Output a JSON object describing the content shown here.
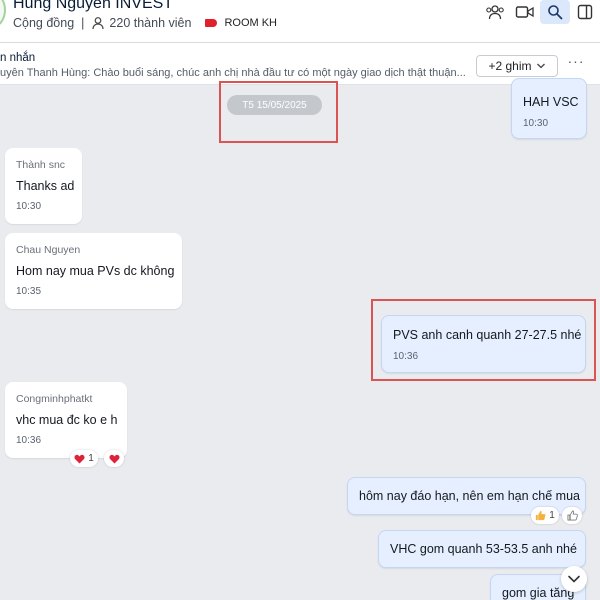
{
  "header": {
    "title": "Hùng Nguyễn INVEST",
    "community_label": "Cộng đồng",
    "member_count": "220 thành viên",
    "tag_label": "ROOM KH",
    "tag_color": "#e0202a",
    "icons": [
      "group-add-icon",
      "video-call-icon",
      "search-icon",
      "sidebar-toggle-icon"
    ]
  },
  "pinned": {
    "title": "n nhắn",
    "preview": "uyễn Thanh Hùng: Chào buổi sáng, chúc anh chị nhà đầu tư có một ngày giao dịch thật thuận...",
    "pins_button": "+2 ghim",
    "more_label": "···"
  },
  "date_divider": "T5 15/05/2025",
  "messages": [
    {
      "text": "HAH VSC",
      "time": "10:30"
    },
    {
      "sender": "Thành snc",
      "text": "Thanks ad",
      "time": "10:30"
    },
    {
      "sender": "Chau Nguyen",
      "text": "Hom nay mua PVs dc không",
      "time": "10:35"
    },
    {
      "text": "PVS anh canh quanh 27-27.5 nhé",
      "time": "10:36"
    },
    {
      "sender": "Congminhphatkt",
      "text": "vhc mua đc ko e h",
      "time": "10:36",
      "reaction_count": "1"
    },
    {
      "text": "hôm nay đáo hạn, nên em hạn chế mua",
      "reaction_count": "1"
    },
    {
      "text": "VHC gom quanh 53-53.5 anh nhé"
    },
    {
      "text": "gom gia tăng"
    }
  ],
  "colors": {
    "accent": "#0068ff",
    "outgoing_bubble": "#e5efff",
    "highlight": "#db5453",
    "reaction_heart": "#e0213a",
    "reaction_like": "#f3b23c"
  }
}
